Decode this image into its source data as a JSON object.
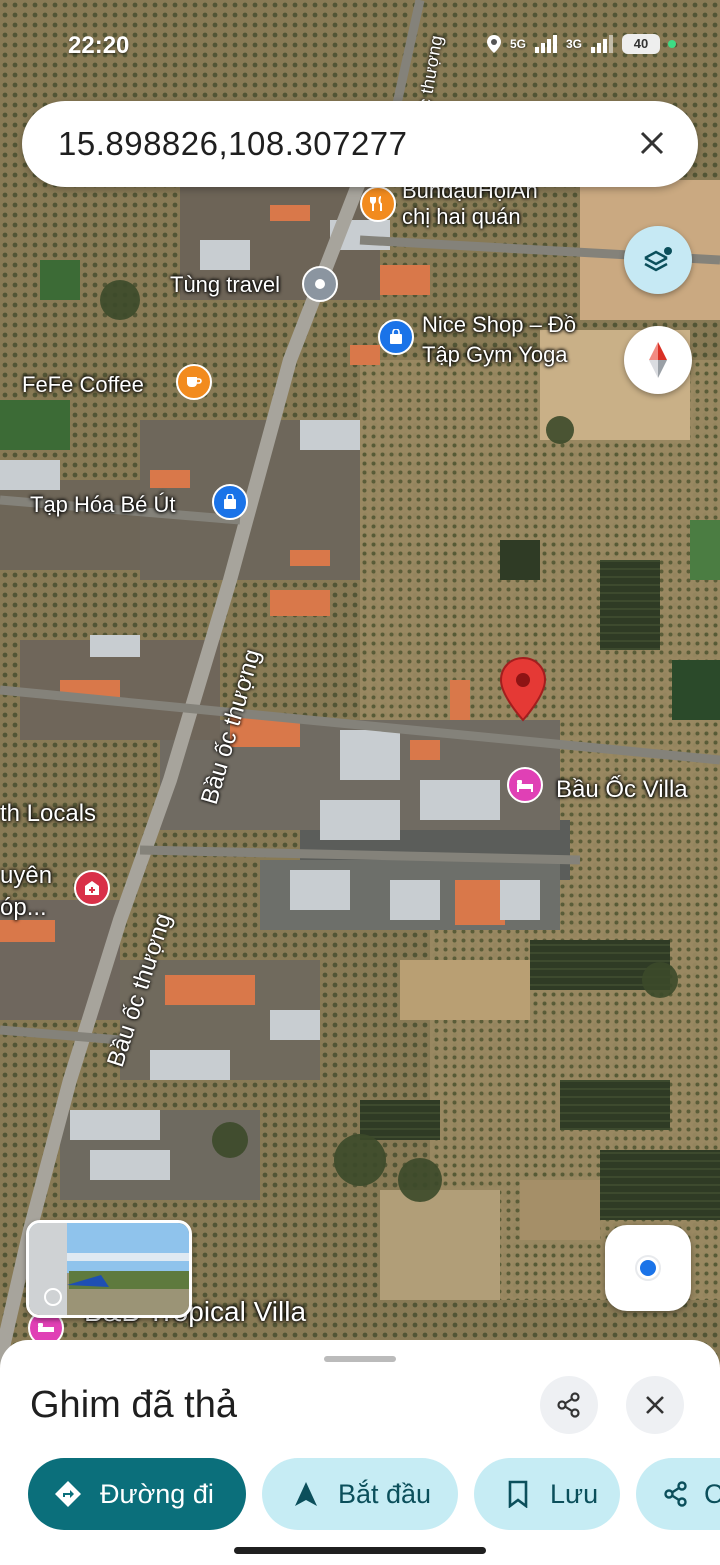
{
  "status_bar": {
    "time": "22:20",
    "network_1": "5G",
    "network_2": "3G",
    "battery": "40"
  },
  "search": {
    "value": "15.898826,108.307277",
    "clear_icon": "close-icon"
  },
  "map": {
    "type": "satellite",
    "pois": [
      {
        "name": "BunđậuHộiAn chị hai quán",
        "line1": "BunđậuHộiAn",
        "line2": "chị hai quán",
        "icon": "restaurant-icon",
        "color": "#f28b1e"
      },
      {
        "name": "Tùng travel",
        "icon": "pin-icon",
        "color": "#8b95a0"
      },
      {
        "name": "Nice Shop – Đồ Tập Gym Yoga",
        "line1": "Nice Shop – Đồ",
        "line2": "Tập Gym Yoga",
        "icon": "shopping-bag-icon",
        "color": "#1a73e8"
      },
      {
        "name": "FeFe Coffee",
        "icon": "coffee-icon",
        "color": "#f28b1e"
      },
      {
        "name": "Tạp Hóa Bé Út",
        "icon": "shopping-bag-icon",
        "color": "#1a73e8"
      },
      {
        "name": "Bầu Ốc Villa",
        "icon": "bed-icon",
        "color": "#e040b5"
      },
      {
        "name": "th Locals",
        "icon": "",
        "color": ""
      },
      {
        "name": "uyên",
        "line1": "uyên",
        "line2": "óp...",
        "icon": "medical-icon",
        "color": "#d93048"
      },
      {
        "name": "B&B Tropical Villa",
        "icon": "bed-icon",
        "color": "#e040b5"
      }
    ],
    "streets": [
      "Bầu ốc thượng",
      "Bầu ốc thượng",
      "Bầu ốc thượng",
      "Bầu ốc thượng"
    ],
    "dropped_pin_color": "#e53935"
  },
  "controls": {
    "layers_icon": "layers-icon",
    "compass_icon": "compass-icon",
    "locate_icon": "my-location-icon"
  },
  "sheet": {
    "title": "Ghim đã thả",
    "share_icon": "share-icon",
    "close_icon": "close-icon",
    "actions": [
      {
        "label": "Đường đi",
        "icon": "directions-icon"
      },
      {
        "label": "Bắt đầu",
        "icon": "navigation-arrow-icon"
      },
      {
        "label": "Lưu",
        "icon": "bookmark-icon"
      },
      {
        "label": "C",
        "icon": "share-icon"
      }
    ]
  }
}
